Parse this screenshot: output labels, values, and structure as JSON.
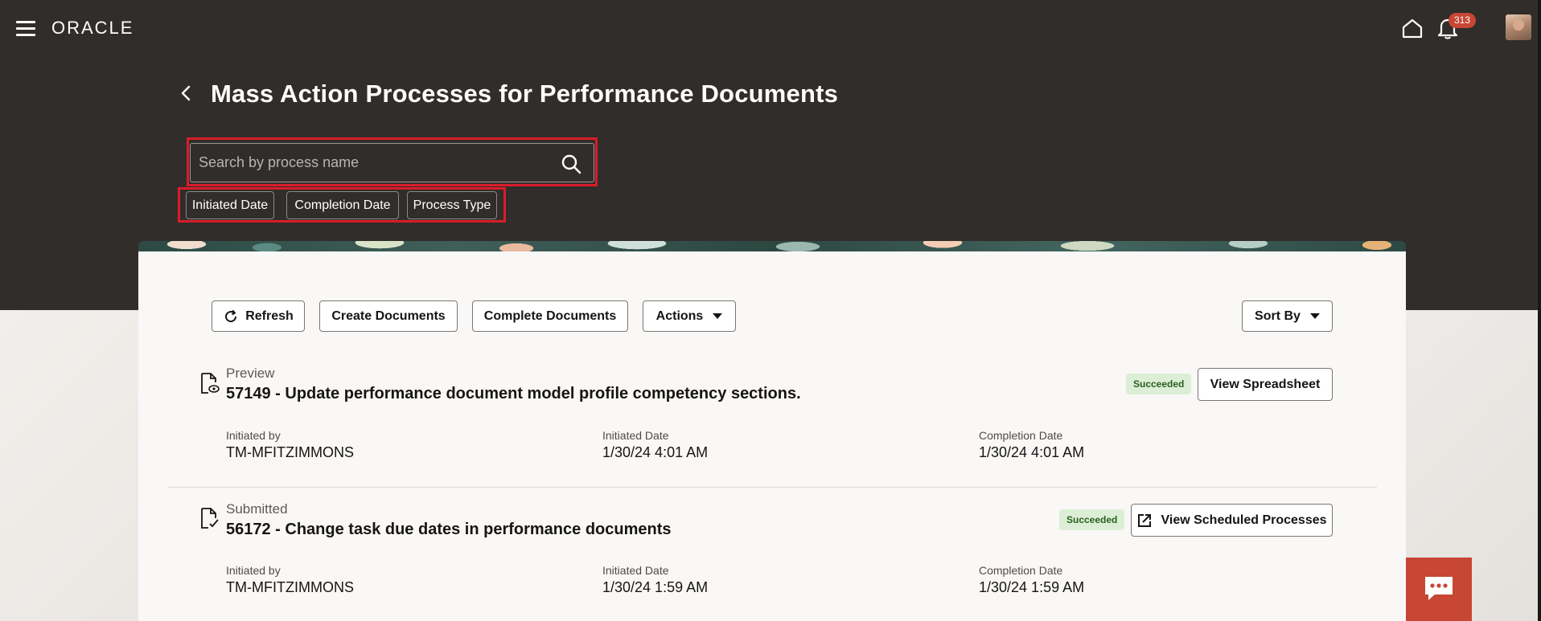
{
  "header": {
    "logo": "ORACLE",
    "notification_count": "313"
  },
  "page": {
    "title": "Mass Action Processes for Performance Documents"
  },
  "search": {
    "placeholder": "Search by process name"
  },
  "filters": [
    "Initiated Date",
    "Completion Date",
    "Process Type"
  ],
  "toolbar": {
    "refresh_label": "Refresh",
    "create_label": "Create Documents",
    "complete_label": "Complete Documents",
    "actions_label": "Actions",
    "sort_label": "Sort By"
  },
  "processes": [
    {
      "status": "Preview",
      "title": "57149 - Update performance document model profile competency sections.",
      "badge": "Succeeded",
      "action_label": "View Spreadsheet",
      "initiated_by_label": "Initiated by",
      "initiated_by": "TM-MFITZIMMONS",
      "initiated_date_label": "Initiated Date",
      "initiated_date": "1/30/24 4:01 AM",
      "completion_date_label": "Completion Date",
      "completion_date": "1/30/24 4:01 AM"
    },
    {
      "status": "Submitted",
      "title": "56172 - Change task due dates in performance documents",
      "badge": "Succeeded",
      "action_label": "View Scheduled Processes",
      "initiated_by_label": "Initiated by",
      "initiated_by": "TM-MFITZIMMONS",
      "initiated_date_label": "Initiated Date",
      "initiated_date": "1/30/24 1:59 AM",
      "completion_date_label": "Completion Date",
      "completion_date": "1/30/24 1:59 AM"
    }
  ],
  "colors": {
    "header_bg": "#312d2a",
    "highlight_red": "#d91c2a",
    "badge_bg": "#dcefd6",
    "chat_red": "#c74634"
  }
}
